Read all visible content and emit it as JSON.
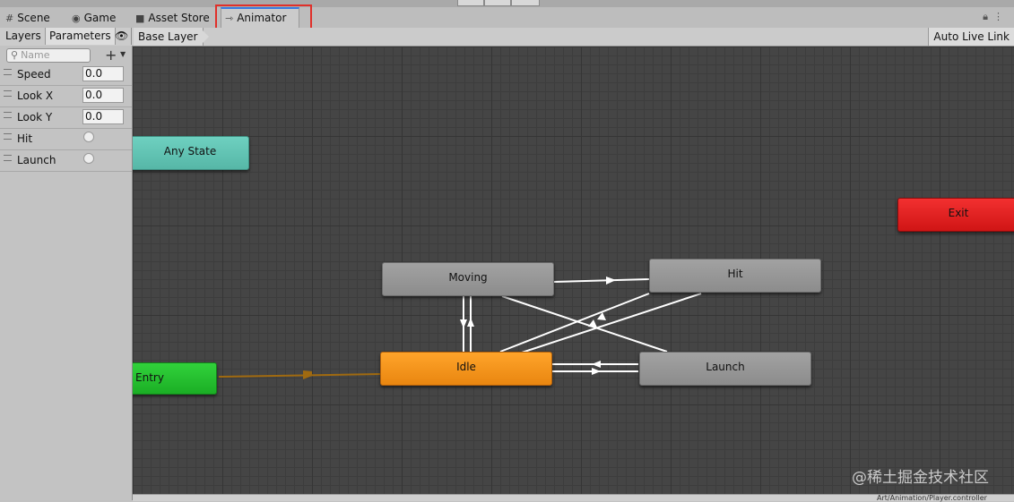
{
  "window": {
    "tabs": [
      {
        "label": "Scene",
        "icon": "grid-icon"
      },
      {
        "label": "Game",
        "icon": "gamepad-icon"
      },
      {
        "label": "Asset Store",
        "icon": "store-bag-icon"
      },
      {
        "label": "Animator",
        "icon": "animator-icon",
        "active": true
      }
    ]
  },
  "toolbar": {
    "layers_label": "Layers",
    "parameters_label": "Parameters",
    "breadcrumb": "Base Layer",
    "auto_live_link": "Auto Live Link"
  },
  "parameters": {
    "search_placeholder": "Name",
    "items": [
      {
        "name": "Speed",
        "type": "float",
        "value": "0.0"
      },
      {
        "name": "Look X",
        "type": "float",
        "value": "0.0"
      },
      {
        "name": "Look Y",
        "type": "float",
        "value": "0.0"
      },
      {
        "name": "Hit",
        "type": "trigger",
        "value": ""
      },
      {
        "name": "Launch",
        "type": "trigger",
        "value": ""
      }
    ]
  },
  "graph": {
    "states": {
      "any_state": "Any State",
      "entry": "Entry",
      "exit": "Exit",
      "moving": "Moving",
      "hit": "Hit",
      "idle": "Idle",
      "launch": "Launch"
    },
    "default_state": "Idle",
    "colors": {
      "any_state": "#5ec4b4",
      "entry": "#25c22f",
      "exit": "#e01e1e",
      "default_state": "#f7941d",
      "state": "#959595",
      "entry_transition": "#a06a10",
      "transition": "#ffffff"
    }
  },
  "status": {
    "path": "Art/Animation/Player.controller"
  },
  "watermark": "@稀土掘金技术社区"
}
